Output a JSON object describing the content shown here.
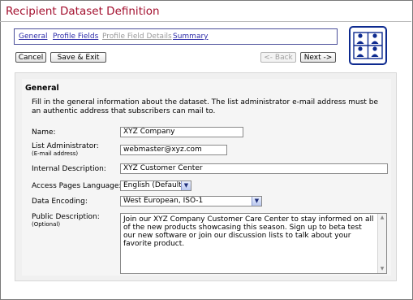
{
  "page": {
    "title": "Recipient Dataset Definition"
  },
  "tabs": [
    {
      "label": "General",
      "state": "link"
    },
    {
      "label": "Profile Fields",
      "state": "link"
    },
    {
      "label": "Profile Field Details",
      "state": "disabled"
    },
    {
      "label": "Summary",
      "state": "link"
    }
  ],
  "toolbar": {
    "cancel_label": "Cancel",
    "save_exit_label": "Save & Exit",
    "back_label": "<- Back",
    "next_label": "Next ->"
  },
  "logo": {
    "icon": "people-grid-icon",
    "color": "#0d2a8f"
  },
  "section": {
    "title": "General",
    "intro": "Fill in the general information about the dataset. The list administrator e-mail address must be an authentic address that subscribers can mail to."
  },
  "form": {
    "name": {
      "label": "Name:",
      "value": "XYZ Company"
    },
    "list_admin": {
      "label": "List Administrator:",
      "sublabel": "(E-mail address)",
      "value": "webmaster@xyz.com"
    },
    "internal_desc": {
      "label": "Internal Description:",
      "value": "XYZ Customer Center"
    },
    "access_lang": {
      "label": "Access Pages Language:",
      "value": "English (Default)"
    },
    "encoding": {
      "label": "Data Encoding:",
      "value": "West European, ISO-1"
    },
    "public_desc": {
      "label": "Public Description:",
      "sublabel": "(Optional)",
      "value": "Join our XYZ Company Customer Care Center to stay informed on all of the new products showcasing this season. Sign up to beta test our new software or join our discussion lists to talk about your favorite product."
    }
  },
  "colors": {
    "title": "#a30f2e",
    "link": "#2c2ba8",
    "nav_border": "#4a4f9a"
  }
}
